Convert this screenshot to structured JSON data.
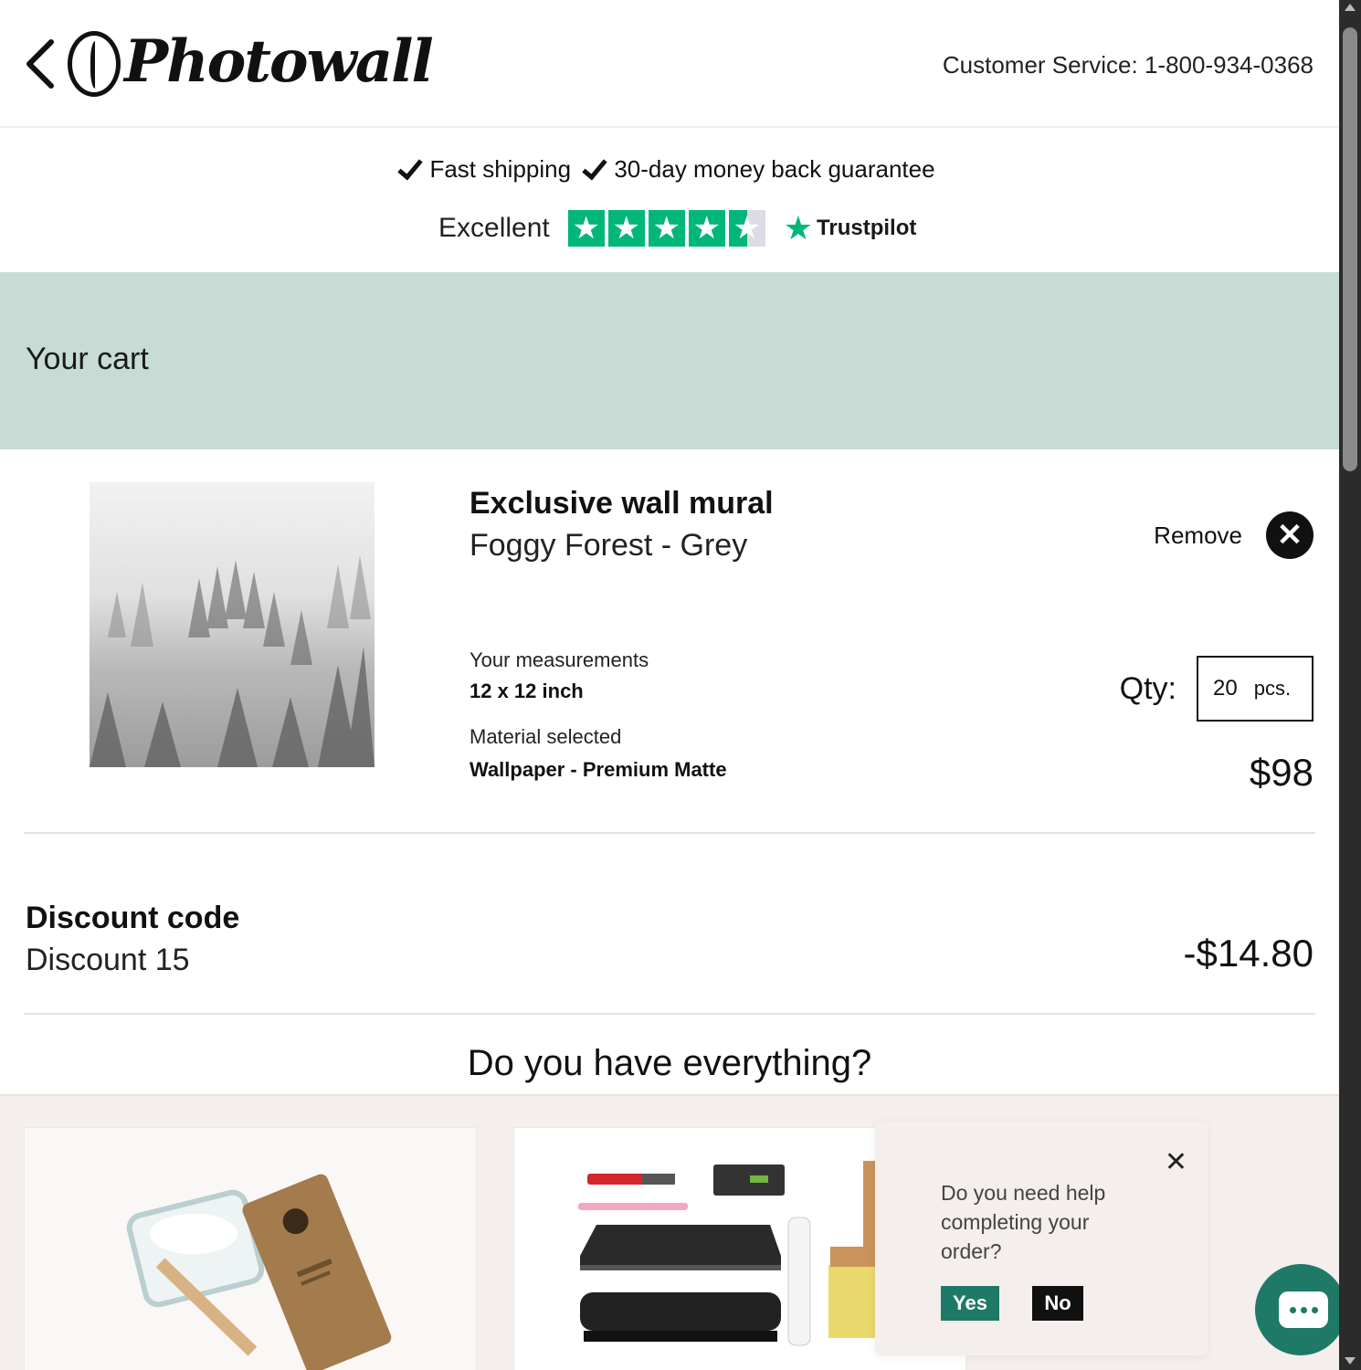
{
  "header": {
    "logo_text": "Photowall",
    "customer_service": "Customer Service: 1-800-934-0368"
  },
  "trust": {
    "usp1": "Fast shipping",
    "usp2": "30-day money back guarantee",
    "rating_word": "Excellent",
    "rating_stars": 4.5,
    "brand": "Trustpilot",
    "brand_color": "#00b67a"
  },
  "cart": {
    "title": "Your cart",
    "band_color": "#c6dcd4"
  },
  "item": {
    "type": "Exclusive wall mural",
    "name": "Foggy Forest - Grey",
    "measurements_label": "Your measurements",
    "measurements_value": "12 x 12 inch",
    "material_label": "Material selected",
    "material_value": "Wallpaper - Premium Matte",
    "remove_label": "Remove",
    "qty_label": "Qty:",
    "qty_value": "20",
    "qty_unit": "pcs.",
    "price": "$98"
  },
  "discount": {
    "title": "Discount code",
    "name": "Discount 15",
    "amount": "-$14.80"
  },
  "upsell": {
    "heading": "Do you have everything?"
  },
  "help_popup": {
    "question": "Do you need help completing your order?",
    "yes": "Yes",
    "no": "No",
    "accent_color": "#1e7a66"
  }
}
